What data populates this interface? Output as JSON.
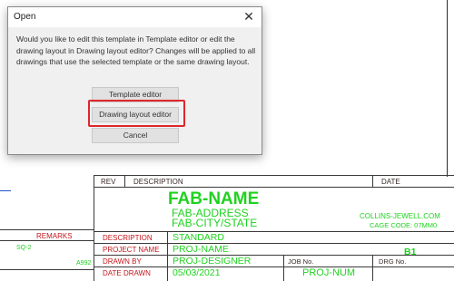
{
  "dialog": {
    "title": "Open",
    "message": "Would you like to edit this template in Template editor or edit the drawing layout in Drawing layout editor? Changes will be applied to all drawings that use the selected template or the same drawing layout.",
    "buttons": {
      "template_editor": "Template editor",
      "drawing_layout_editor": "Drawing layout editor",
      "cancel": "Cancel"
    },
    "close_glyph": "✕"
  },
  "title_block": {
    "headers": {
      "rev": "REV",
      "description": "DESCRIPTION",
      "date": "DATE"
    },
    "fab_name": "FAB-NAME",
    "fab_address": "FAB-ADDRESS",
    "fab_city_state": "FAB-CITY/STATE",
    "website": "COLLINS-JEWELL.COM",
    "cage_code": "CAGE CODE: 07MM0",
    "rows": {
      "description_label": "DESCRIPTION",
      "description_value": "STANDARD",
      "project_name_label": "PROJECT NAME",
      "project_name_value": "PROJ-NAME",
      "drawn_by_label": "DRAWN BY",
      "drawn_by_value": "PROJ-DESIGNER",
      "date_drawn_label": "DATE DRAWN",
      "date_drawn_value": "05/03/2021"
    },
    "job_no_label": "JOB No.",
    "job_no_value": "PROJ-NUM",
    "drg_no_label": "DRG No.",
    "sheet_value": "B1"
  },
  "left_table": {
    "remarks_header": "REMARKS",
    "row1_value": "SQ-2",
    "row2_value": "A992"
  },
  "colors": {
    "title_block_text": "#1fd21f",
    "label_red": "#c4161c",
    "highlight": "#e0262b"
  }
}
